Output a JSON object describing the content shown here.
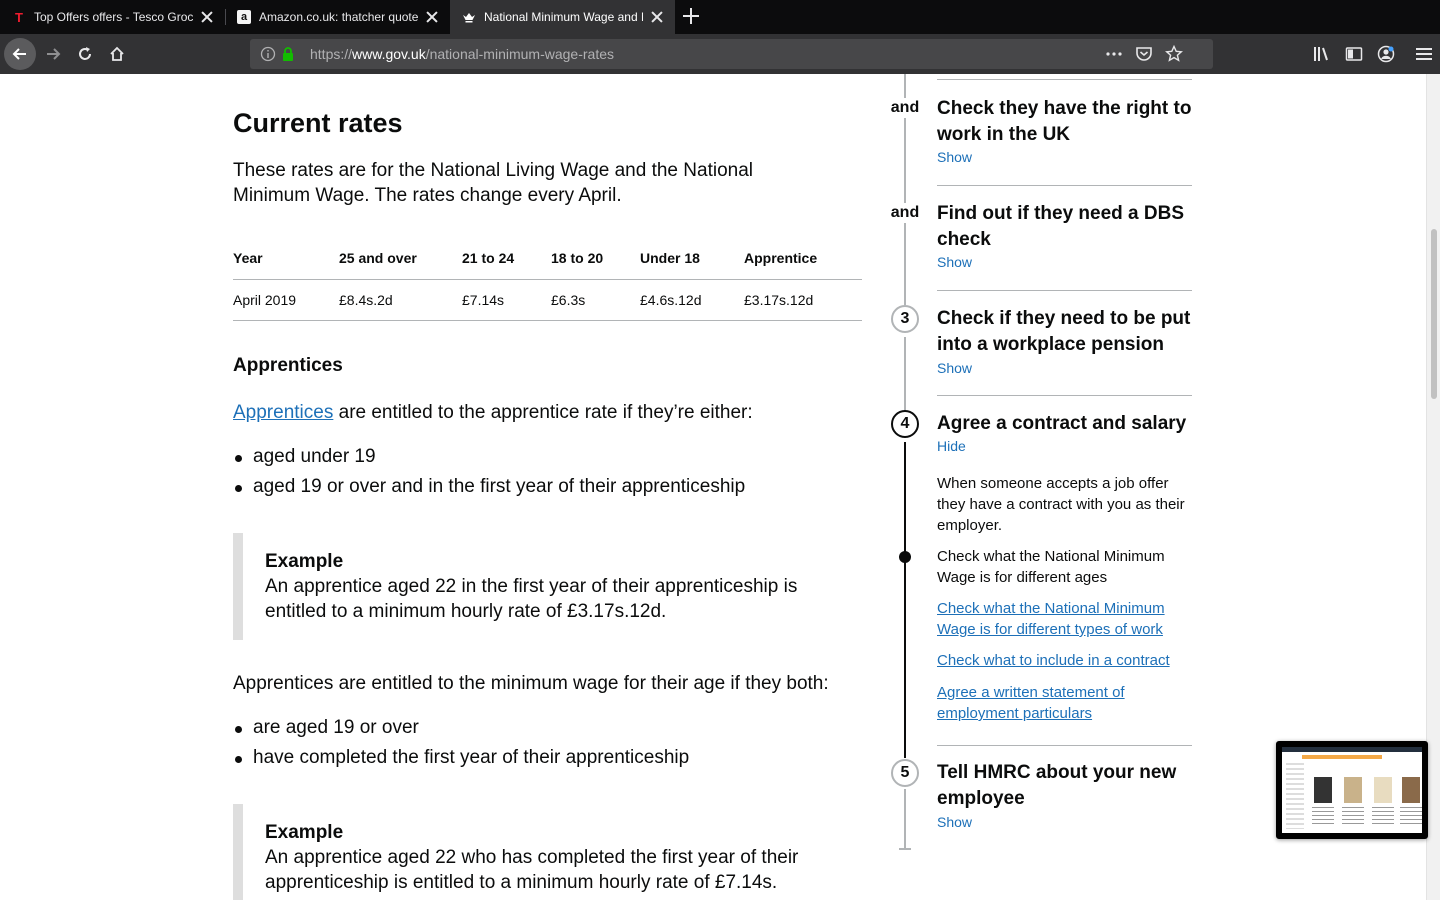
{
  "browser": {
    "tabs": [
      {
        "title": "Top Offers offers - Tesco Groce",
        "favicon": "T",
        "active": false
      },
      {
        "title": "Amazon.co.uk: thatcher quotes",
        "favicon": "a",
        "active": false
      },
      {
        "title": "National Minimum Wage and Na",
        "favicon": "crown",
        "active": true
      }
    ],
    "url": {
      "scheme": "https://",
      "host": "www.gov.uk",
      "path": "/national-minimum-wage-rates"
    }
  },
  "content": {
    "heading": "Current rates",
    "lead": "These rates are for the National Living Wage and the National Minimum Wage. The rates change every April.",
    "table": {
      "headers": [
        "Year",
        "25 and over",
        "21 to 24",
        "18 to 20",
        "Under 18",
        "Apprentice"
      ],
      "rows": [
        [
          "April 2019",
          "£8.4s.2d",
          "£7.14s",
          "£6.3s",
          "£4.6s.12d",
          "£3.17s.12d"
        ]
      ]
    },
    "apprentices": {
      "heading": "Apprentices",
      "para1_link": "Apprentices",
      "para1_rest": " are entitled to the apprentice rate if they’re either:",
      "list1": [
        "aged under 19",
        "aged 19 or over and in the first year of their apprenticeship"
      ],
      "example1": {
        "title": "Example",
        "text": "An apprentice aged 22 in the first year of their apprenticeship is entitled to a minimum hourly rate of £3.17s.12d."
      },
      "para2": "Apprentices are entitled to the minimum wage for their age if they both:",
      "list2": [
        "are aged 19 or over",
        "have completed the first year of their apprenticeship"
      ],
      "example2": {
        "title": "Example",
        "text": "An apprentice aged 22 who has completed the first year of their apprenticeship is entitled to a minimum hourly rate of £7.14s."
      }
    }
  },
  "step_nav": {
    "and_label": "and",
    "steps": [
      {
        "marker": "and",
        "title": "Check they have the right to work in the UK",
        "toggle": "Show"
      },
      {
        "marker": "and",
        "title": "Find out if they need a DBS check",
        "toggle": "Show"
      },
      {
        "marker": "3",
        "title": "Check if they need to be put into a workplace pension",
        "toggle": "Show"
      },
      {
        "marker": "4",
        "title": "Agree a contract and salary",
        "toggle": "Hide",
        "body": "When someone accepts a job offer they have a contract with you as their employer.",
        "current_item": "Check what the National Minimum Wage is for different ages",
        "links": [
          "Check what the National Minimum Wage is for different types of work",
          "Check what to include in a contract",
          "Agree a written statement of employment particulars"
        ]
      },
      {
        "marker": "5",
        "title": "Tell HMRC about your new employee",
        "toggle": "Show"
      }
    ]
  },
  "colors": {
    "link": "#1d70b8",
    "text": "#0b0c0c",
    "chrome_dark": "#0c0c0d",
    "chrome_toolbar": "#323234"
  }
}
